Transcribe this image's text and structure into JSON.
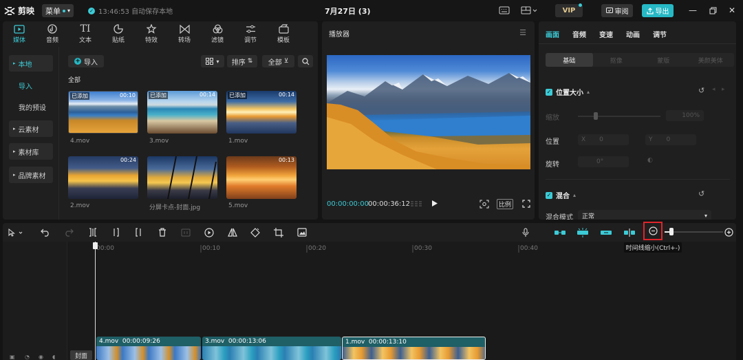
{
  "topbar": {
    "app_name": "剪映",
    "menu_label": "菜单",
    "save_status": "13:46:53 自动保存本地",
    "project_title": "7月27日 (3)",
    "vip_label": "VIP",
    "review_label": "审阅",
    "export_label": "导出"
  },
  "tool_tabs": [
    {
      "label": "媒体",
      "icon": "media-icon"
    },
    {
      "label": "音频",
      "icon": "audio-icon"
    },
    {
      "label": "文本",
      "icon": "text-icon"
    },
    {
      "label": "贴纸",
      "icon": "sticker-icon"
    },
    {
      "label": "特效",
      "icon": "effects-icon"
    },
    {
      "label": "转场",
      "icon": "transition-icon"
    },
    {
      "label": "滤镜",
      "icon": "filter-icon"
    },
    {
      "label": "调节",
      "icon": "adjust-icon"
    },
    {
      "label": "模板",
      "icon": "template-icon"
    }
  ],
  "side_nav": {
    "local": "本地",
    "import": "导入",
    "my_presets": "我的预设",
    "cloud": "云素材",
    "library": "素材库",
    "brand": "品牌素材"
  },
  "media": {
    "import_label": "导入",
    "sort_label": "排序",
    "filter_label": "全部",
    "all_label": "全部",
    "items": [
      {
        "name": "4.mov",
        "badge": "已添加",
        "duration": "00:10"
      },
      {
        "name": "3.mov",
        "badge": "已添加",
        "duration": "00:14"
      },
      {
        "name": "1.mov",
        "badge": "已添加",
        "duration": "00:14"
      },
      {
        "name": "2.mov",
        "badge": "",
        "duration": "00:24"
      },
      {
        "name": "分屏卡点-封面.jpg",
        "badge": "",
        "duration": ""
      },
      {
        "name": "5.mov",
        "badge": "",
        "duration": "00:13"
      }
    ]
  },
  "player": {
    "title": "播放器",
    "current_time": "00:00:00:00",
    "total_time": "00:00:36:12",
    "ratio_label": "比例"
  },
  "inspector": {
    "tabs": [
      "画面",
      "音频",
      "变速",
      "动画",
      "调节"
    ],
    "subtabs": [
      "基础",
      "抠像",
      "蒙版",
      "美颜美体"
    ],
    "position_size": "位置大小",
    "scale_label": "缩放",
    "scale_value": "100%",
    "position_label": "位置",
    "x_label": "X",
    "x_value": "0",
    "y_label": "Y",
    "y_value": "0",
    "rotate_label": "旋转",
    "rotate_value": "0°",
    "blend": "混合",
    "blend_mode_label": "混合模式",
    "blend_mode_value": "正常"
  },
  "timeline": {
    "tooltip": "时间线缩小(Ctrl+-)",
    "ruler": [
      "00:00",
      "00:10",
      "00:20",
      "00:30",
      "00:40"
    ],
    "cover_label": "封面",
    "zoom_level": 0.12,
    "clips": [
      {
        "name": "4.mov",
        "duration": "00:00:09:26"
      },
      {
        "name": "3.mov",
        "duration": "00:00:13:06"
      },
      {
        "name": "1.mov",
        "duration": "00:00:13:10"
      }
    ]
  },
  "colors": {
    "accent": "#3ccbd6",
    "export": "#26b8c4",
    "highlight": "#e0242b"
  }
}
